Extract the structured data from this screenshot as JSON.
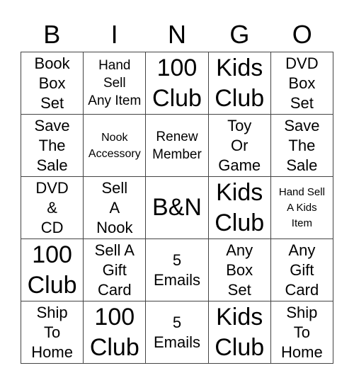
{
  "header": {
    "letters": [
      "B",
      "I",
      "N",
      "G",
      "O"
    ]
  },
  "card": {
    "rows": [
      [
        {
          "text": "Book\nBox\nSet",
          "size": "l"
        },
        {
          "text": "Hand\nSell\nAny Item",
          "size": "m"
        },
        {
          "text": "100\nClub",
          "size": "xl"
        },
        {
          "text": "Kids\nClub",
          "size": "xl"
        },
        {
          "text": "DVD\nBox\nSet",
          "size": "l"
        }
      ],
      [
        {
          "text": "Save\nThe\nSale",
          "size": "l"
        },
        {
          "text": "Nook\nAccessory",
          "size": "s"
        },
        {
          "text": "Renew\nMember",
          "size": "m"
        },
        {
          "text": "Toy\nOr\nGame",
          "size": "l"
        },
        {
          "text": "Save\nThe\nSale",
          "size": "l"
        }
      ],
      [
        {
          "text": "DVD\n&\nCD",
          "size": "l"
        },
        {
          "text": "Sell\nA\nNook",
          "size": "l"
        },
        {
          "text": "B&N",
          "size": "xl"
        },
        {
          "text": "Kids\nClub",
          "size": "xl"
        },
        {
          "text": "Hand Sell\nA Kids\nItem",
          "size": "xs"
        }
      ],
      [
        {
          "text": "100\nClub",
          "size": "xl"
        },
        {
          "text": "Sell A\nGift\nCard",
          "size": "l"
        },
        {
          "text": "5\nEmails",
          "size": "l"
        },
        {
          "text": "Any\nBox\nSet",
          "size": "l"
        },
        {
          "text": "Any\nGift\nCard",
          "size": "l"
        }
      ],
      [
        {
          "text": "Ship\nTo\nHome",
          "size": "l"
        },
        {
          "text": "100\nClub",
          "size": "xl"
        },
        {
          "text": "5\nEmails",
          "size": "l"
        },
        {
          "text": "Kids\nClub",
          "size": "xl"
        },
        {
          "text": "Ship\nTo\nHome",
          "size": "l"
        }
      ]
    ]
  }
}
